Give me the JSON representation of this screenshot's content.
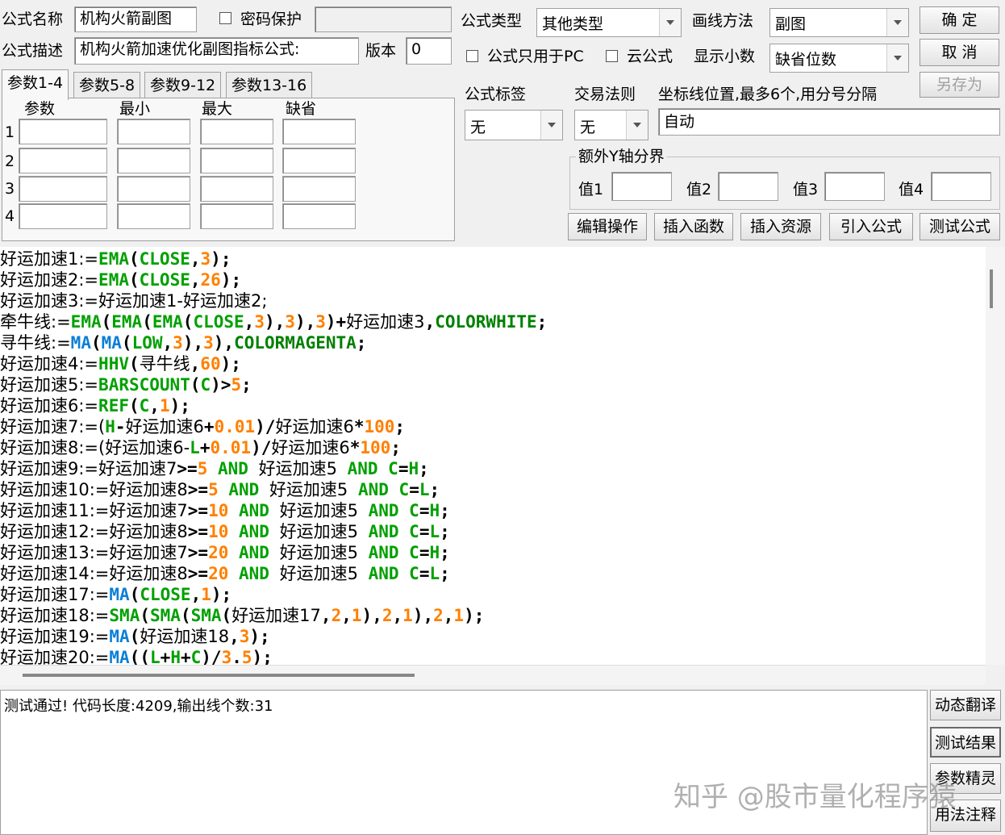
{
  "header": {
    "name_label": "公式名称",
    "name_value": "机构火箭副图",
    "password_label": "密码保护",
    "desc_label": "公式描述",
    "desc_value": "机构火箭加速优化副图指标公式:",
    "version_label": "版本",
    "version_value": "0",
    "type_label": "公式类型",
    "type_value": "其他类型",
    "draw_label": "画线方法",
    "draw_value": "副图",
    "pc_only_label": "公式只用于PC",
    "cloud_label": "云公式",
    "decimals_label": "显示小数",
    "decimals_value": "缺省位数"
  },
  "buttons": {
    "ok": "确 定",
    "cancel": "取 消",
    "save_as": "另存为"
  },
  "tabs": [
    "参数1-4",
    "参数5-8",
    "参数9-12",
    "参数13-16"
  ],
  "params": {
    "headers": [
      "参数",
      "最小",
      "最大",
      "缺省"
    ],
    "rows": [
      "1",
      "2",
      "3",
      "4"
    ]
  },
  "right": {
    "tag_label": "公式标签",
    "tag_value": "无",
    "trade_label": "交易法则",
    "trade_value": "无",
    "axis_label": "坐标线位置,最多6个,用分号分隔",
    "axis_value": "自动",
    "extra_title": "额外Y轴分界",
    "val_labels": [
      "值1",
      "值2",
      "值3",
      "值4"
    ]
  },
  "toolbar": [
    "编辑操作",
    "插入函数",
    "插入资源",
    "引入公式",
    "测试公式"
  ],
  "code_lines": [
    [
      [
        "t",
        "好运加速1:="
      ],
      [
        "f",
        "EMA"
      ],
      [
        "p",
        "("
      ],
      [
        "f",
        "CLOSE"
      ],
      [
        "p",
        ","
      ],
      [
        "n",
        "3"
      ],
      [
        "p",
        ");"
      ]
    ],
    [
      [
        "t",
        "好运加速2:="
      ],
      [
        "f",
        "EMA"
      ],
      [
        "p",
        "("
      ],
      [
        "f",
        "CLOSE"
      ],
      [
        "p",
        ","
      ],
      [
        "n",
        "26"
      ],
      [
        "p",
        ");"
      ]
    ],
    [
      [
        "t",
        "好运加速3:=好运加速1-好运加速2;"
      ]
    ],
    [
      [
        "t",
        "牵牛线:="
      ],
      [
        "f",
        "EMA"
      ],
      [
        "p",
        "("
      ],
      [
        "f",
        "EMA"
      ],
      [
        "p",
        "("
      ],
      [
        "f",
        "EMA"
      ],
      [
        "p",
        "("
      ],
      [
        "f",
        "CLOSE"
      ],
      [
        "p",
        ","
      ],
      [
        "n",
        "3"
      ],
      [
        "p",
        "),"
      ],
      [
        "n",
        "3"
      ],
      [
        "p",
        "),"
      ],
      [
        "n",
        "3"
      ],
      [
        "p",
        ")+"
      ],
      [
        "t",
        "好运加速3"
      ],
      [
        "p",
        ","
      ],
      [
        "c",
        "COLORWHITE"
      ],
      [
        "p",
        ";"
      ]
    ],
    [
      [
        "t",
        "寻牛线:="
      ],
      [
        "m",
        "MA"
      ],
      [
        "p",
        "("
      ],
      [
        "m",
        "MA"
      ],
      [
        "p",
        "("
      ],
      [
        "f",
        "LOW"
      ],
      [
        "p",
        ","
      ],
      [
        "n",
        "3"
      ],
      [
        "p",
        "),"
      ],
      [
        "n",
        "3"
      ],
      [
        "p",
        "),"
      ],
      [
        "c",
        "COLORMAGENTA"
      ],
      [
        "p",
        ";"
      ]
    ],
    [
      [
        "t",
        "好运加速4:="
      ],
      [
        "f",
        "HHV"
      ],
      [
        "p",
        "("
      ],
      [
        "t",
        "寻牛线"
      ],
      [
        "p",
        ","
      ],
      [
        "n",
        "60"
      ],
      [
        "p",
        ");"
      ]
    ],
    [
      [
        "t",
        "好运加速5:="
      ],
      [
        "f",
        "BARSCOUNT"
      ],
      [
        "p",
        "("
      ],
      [
        "f",
        "C"
      ],
      [
        "p",
        ")>"
      ],
      [
        "n",
        "5"
      ],
      [
        "p",
        ";"
      ]
    ],
    [
      [
        "t",
        "好运加速6:="
      ],
      [
        "f",
        "REF"
      ],
      [
        "p",
        "("
      ],
      [
        "f",
        "C"
      ],
      [
        "p",
        ","
      ],
      [
        "n",
        "1"
      ],
      [
        "p",
        ");"
      ]
    ],
    [
      [
        "t",
        "好运加速7:=("
      ],
      [
        "f",
        "H"
      ],
      [
        "p",
        "-"
      ],
      [
        "t",
        "好运加速6"
      ],
      [
        "p",
        "+"
      ],
      [
        "n",
        "0.01"
      ],
      [
        "p",
        ")/"
      ],
      [
        "t",
        "好运加速6"
      ],
      [
        "p",
        "*"
      ],
      [
        "n",
        "100"
      ],
      [
        "p",
        ";"
      ]
    ],
    [
      [
        "t",
        "好运加速8:=(好运加速6-"
      ],
      [
        "f",
        "L"
      ],
      [
        "p",
        "+"
      ],
      [
        "n",
        "0.01"
      ],
      [
        "p",
        ")/"
      ],
      [
        "t",
        "好运加速6"
      ],
      [
        "p",
        "*"
      ],
      [
        "n",
        "100"
      ],
      [
        "p",
        ";"
      ]
    ],
    [
      [
        "t",
        "好运加速9:=好运加速7"
      ],
      [
        "p",
        ">="
      ],
      [
        "n",
        "5"
      ],
      [
        "k",
        " AND "
      ],
      [
        "t",
        "好运加速5"
      ],
      [
        "k",
        " AND "
      ],
      [
        "f",
        "C"
      ],
      [
        "p",
        "="
      ],
      [
        "f",
        "H"
      ],
      [
        "p",
        ";"
      ]
    ],
    [
      [
        "t",
        "好运加速10:=好运加速8"
      ],
      [
        "p",
        ">="
      ],
      [
        "n",
        "5"
      ],
      [
        "k",
        " AND "
      ],
      [
        "t",
        "好运加速5"
      ],
      [
        "k",
        " AND "
      ],
      [
        "f",
        "C"
      ],
      [
        "p",
        "="
      ],
      [
        "f",
        "L"
      ],
      [
        "p",
        ";"
      ]
    ],
    [
      [
        "t",
        "好运加速11:=好运加速7"
      ],
      [
        "p",
        ">="
      ],
      [
        "n",
        "10"
      ],
      [
        "k",
        " AND "
      ],
      [
        "t",
        "好运加速5"
      ],
      [
        "k",
        " AND "
      ],
      [
        "f",
        "C"
      ],
      [
        "p",
        "="
      ],
      [
        "f",
        "H"
      ],
      [
        "p",
        ";"
      ]
    ],
    [
      [
        "t",
        "好运加速12:=好运加速8"
      ],
      [
        "p",
        ">="
      ],
      [
        "n",
        "10"
      ],
      [
        "k",
        " AND "
      ],
      [
        "t",
        "好运加速5"
      ],
      [
        "k",
        " AND "
      ],
      [
        "f",
        "C"
      ],
      [
        "p",
        "="
      ],
      [
        "f",
        "L"
      ],
      [
        "p",
        ";"
      ]
    ],
    [
      [
        "t",
        "好运加速13:=好运加速7"
      ],
      [
        "p",
        ">="
      ],
      [
        "n",
        "20"
      ],
      [
        "k",
        " AND "
      ],
      [
        "t",
        "好运加速5"
      ],
      [
        "k",
        " AND "
      ],
      [
        "f",
        "C"
      ],
      [
        "p",
        "="
      ],
      [
        "f",
        "H"
      ],
      [
        "p",
        ";"
      ]
    ],
    [
      [
        "t",
        "好运加速14:=好运加速8"
      ],
      [
        "p",
        ">="
      ],
      [
        "n",
        "20"
      ],
      [
        "k",
        " AND "
      ],
      [
        "t",
        "好运加速5"
      ],
      [
        "k",
        " AND "
      ],
      [
        "f",
        "C"
      ],
      [
        "p",
        "="
      ],
      [
        "f",
        "L"
      ],
      [
        "p",
        ";"
      ]
    ],
    [
      [
        "t",
        "好运加速17:="
      ],
      [
        "m",
        "MA"
      ],
      [
        "p",
        "("
      ],
      [
        "f",
        "CLOSE"
      ],
      [
        "p",
        ","
      ],
      [
        "n",
        "1"
      ],
      [
        "p",
        ");"
      ]
    ],
    [
      [
        "t",
        "好运加速18:="
      ],
      [
        "f",
        "SMA"
      ],
      [
        "p",
        "("
      ],
      [
        "f",
        "SMA"
      ],
      [
        "p",
        "("
      ],
      [
        "f",
        "SMA"
      ],
      [
        "p",
        "("
      ],
      [
        "t",
        "好运加速17"
      ],
      [
        "p",
        ","
      ],
      [
        "n",
        "2"
      ],
      [
        "p",
        ","
      ],
      [
        "n",
        "1"
      ],
      [
        "p",
        "),"
      ],
      [
        "n",
        "2"
      ],
      [
        "p",
        ","
      ],
      [
        "n",
        "1"
      ],
      [
        "p",
        "),"
      ],
      [
        "n",
        "2"
      ],
      [
        "p",
        ","
      ],
      [
        "n",
        "1"
      ],
      [
        "p",
        ");"
      ]
    ],
    [
      [
        "t",
        "好运加速19:="
      ],
      [
        "m",
        "MA"
      ],
      [
        "p",
        "("
      ],
      [
        "t",
        "好运加速18"
      ],
      [
        "p",
        ","
      ],
      [
        "n",
        "3"
      ],
      [
        "p",
        ");"
      ]
    ],
    [
      [
        "t",
        "好运加速20:="
      ],
      [
        "m",
        "MA"
      ],
      [
        "p",
        "(("
      ],
      [
        "f",
        "L"
      ],
      [
        "p",
        "+"
      ],
      [
        "f",
        "H"
      ],
      [
        "p",
        "+"
      ],
      [
        "f",
        "C"
      ],
      [
        "p",
        ")/"
      ],
      [
        "n",
        "3"
      ],
      [
        "p",
        "."
      ],
      [
        "n",
        "5"
      ],
      [
        "p",
        ");"
      ]
    ]
  ],
  "status": "测试通过! 代码长度:4209,输出线个数:31",
  "side_buttons": [
    "动态翻译",
    "测试结果",
    "参数精灵",
    "用法注释"
  ],
  "watermark": "知乎 @股市量化程序猿"
}
